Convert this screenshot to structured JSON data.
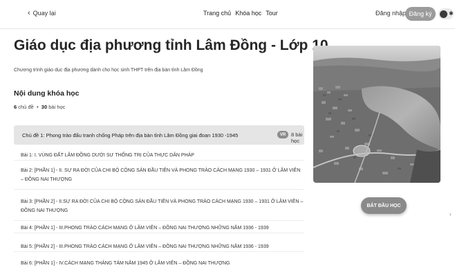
{
  "header": {
    "back_label": "Quay lại",
    "nav": [
      "Trang chủ",
      "Khóa học",
      "Tour"
    ],
    "login_label": "Đăng nhập",
    "register_label": "Đăng ký",
    "theme_toggle_icon": "moon-sun-toggle"
  },
  "course": {
    "title": "Giáo dục địa phương tỉnh Lâm Đồng - Lớp 10",
    "description": "Chương trình giáo dục địa phương dành cho học sinh THPT trên địa bàn tỉnh Lâm Đồng",
    "content_heading": "Nội dung khóa học",
    "topics_count": "6",
    "topics_label": "chủ đề",
    "separator": "•",
    "lessons_count": "30",
    "lessons_label": "bài học"
  },
  "chapter": {
    "title": "Chủ đề 1: Phong trào đấu tranh chống Pháp trên địa bàn tỉnh Lâm Đồng giai đoạn 1930 -1945",
    "badge": "VR",
    "lesson_count": "8 bài học"
  },
  "lessons": [
    "Bài 1: I. VÙNG ĐẤT LÂM ĐỒNG DƯỚI SỰ THỐNG TRỊ CỦA THỰC DÂN PHÁP",
    "Bài 2: [PHẦN 1] - II. SỰ RA ĐỜI CỦA CHI BỘ CỘNG SẢN ĐẦU TIÊN VÀ PHONG TRÀO CÁCH MẠNG 1930 – 1931 Ở LÂM VIÊN – ĐỒNG NAI THƯỢNG",
    "Bài 3: [PHẦN 2] - II.SỰ RA ĐỜI CỦA CHI BỘ CỘNG SẢN ĐẦU TIÊN VÀ PHONG TRÀO CÁCH MẠNG 1930 – 1931 Ở LÂM VIÊN – ĐỒNG NAI THƯỢNG",
    "Bài 4: [PHẦN 1] - III.PHONG TRÀO CÁCH MẠNG Ở LÂM VIÊN – ĐỒNG NAI THƯỢNG NHỮNG NĂM 1936 - 1939",
    "Bài 5: [PHẦN 2] - III.PHONG TRÀO CÁCH MẠNG Ở LÂM VIÊN – ĐỒNG NAI THƯỢNG NHỮNG NĂM 1936 - 1939",
    "Bài 6: [PHẦN 1] - IV.CÁCH MẠNG THÁNG TÁM NĂM 1945 Ở LÂM VIÊN – ĐỒNG NAI THƯỢNG"
  ],
  "sidebar": {
    "image_icon": "city-lake-aerial-photo",
    "start_label": "BẮT ĐẦU HỌC",
    "scroll_icon": "chevron-right-icon"
  }
}
